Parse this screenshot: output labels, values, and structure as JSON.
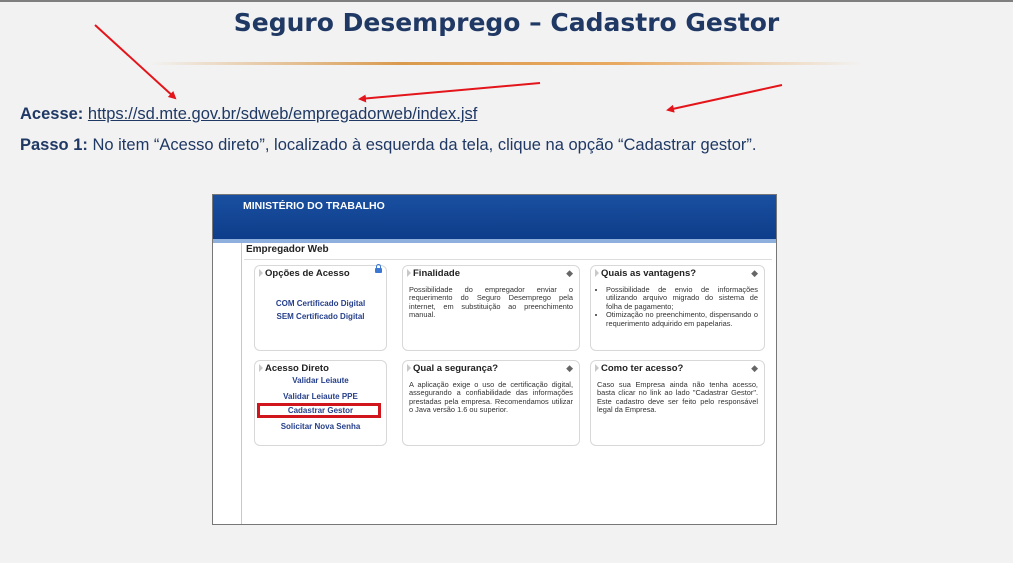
{
  "slide": {
    "title": "Seguro Desemprego – Cadastro Gestor",
    "access_label": "Acesse:",
    "access_url": "https://sd.mte.gov.br/sdweb/empregadorweb/index.jsf",
    "step_label": "Passo 1:",
    "step_text": "No item “Acesso direto”, localizado à esquerda da tela, clique na opção “Cadastrar gestor”."
  },
  "screenshot": {
    "header": "MINISTÉRIO DO TRABALHO",
    "section_title": "Empregador Web",
    "opcoes": {
      "title": "Opções de Acesso",
      "links": [
        "COM Certificado Digital",
        "SEM Certificado Digital"
      ]
    },
    "finalidade": {
      "title": "Finalidade",
      "text": "Possibilidade do empregador enviar o requerimento do Seguro Desemprego pela internet, em substituição ao preenchimento manual."
    },
    "vantagens": {
      "title": "Quais as vantagens?",
      "items": [
        "Possibilidade de envio de informações utilizando arquivo migrado do sistema de folha de pagamento;",
        "Otimização no preenchimento, dispensando o requerimento adquirido em papelarias."
      ]
    },
    "acesso_direto": {
      "title": "Acesso Direto",
      "links": [
        "Validar Leiaute",
        "Validar Leiaute PPE",
        "Cadastrar Gestor",
        "Solicitar Nova Senha"
      ]
    },
    "seguranca": {
      "title": "Qual a segurança?",
      "text": "A aplicação exige o uso de certificação digital, assegurando a confiabilidade das informações prestadas pela empresa. Recomendamos utilizar o Java versão 1.6 ou superior."
    },
    "como": {
      "title": "Como ter acesso?",
      "text": "Caso sua Empresa ainda não tenha acesso, basta clicar no link ao lado \"Cadastrar Gestor\". Este cadastro deve ser feito pelo responsável legal da Empresa."
    }
  },
  "colors": {
    "title": "#1f3864",
    "annotation": "#e3151b",
    "header_blue": "#0d3d8a",
    "link_blue": "#27408b"
  }
}
